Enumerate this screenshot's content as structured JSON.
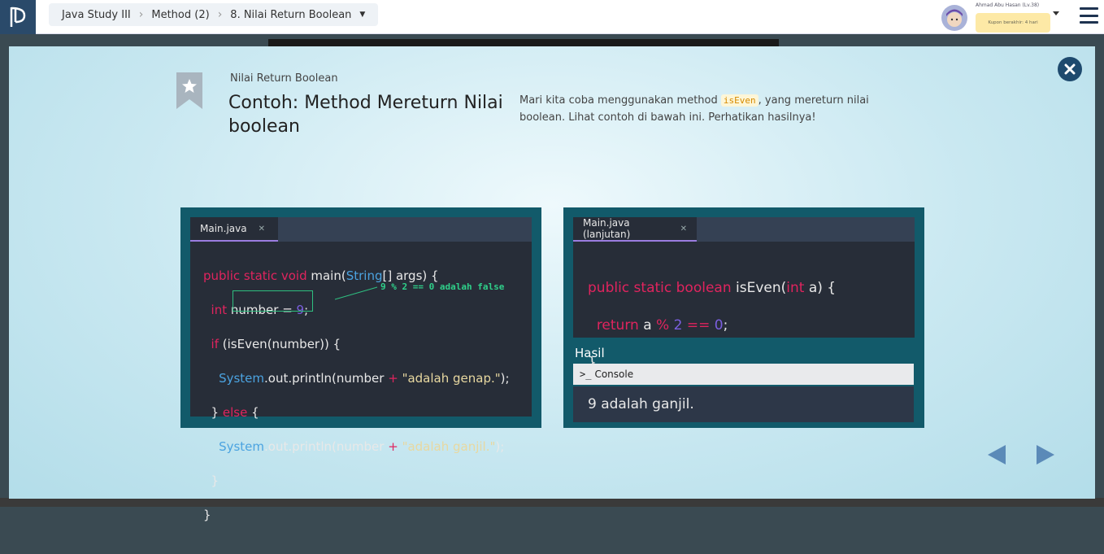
{
  "header": {
    "breadcrumbs": [
      "Java Study III",
      "Method (2)",
      "8. Nilai Return Boolean"
    ],
    "user_name": "Ahmad Abu Hasan (Lv.38)",
    "coupon_text": "Kupon berakhir: 4 hari"
  },
  "slide": {
    "subtitle": "Nilai Return Boolean",
    "title": "Contoh: Method Mereturn Nilai boolean",
    "desc_before": "Mari kita coba menggunakan method ",
    "desc_code": "isEven",
    "desc_after": ", yang mereturn nilai boolean. Lihat contoh di bawah ini. Perhatikan hasilnya!",
    "left_tab": "Main.java",
    "right_tab": "Main.java (lanjutan)",
    "annotation": "9 % 2 == 0 adalah false",
    "result_label": "Hasil",
    "console_label": "Console",
    "console_output": "9 adalah ganjil."
  },
  "colors": {
    "accent": "#125a6a",
    "close": "#1e4a6e",
    "arrow": "#5b8ab8"
  }
}
